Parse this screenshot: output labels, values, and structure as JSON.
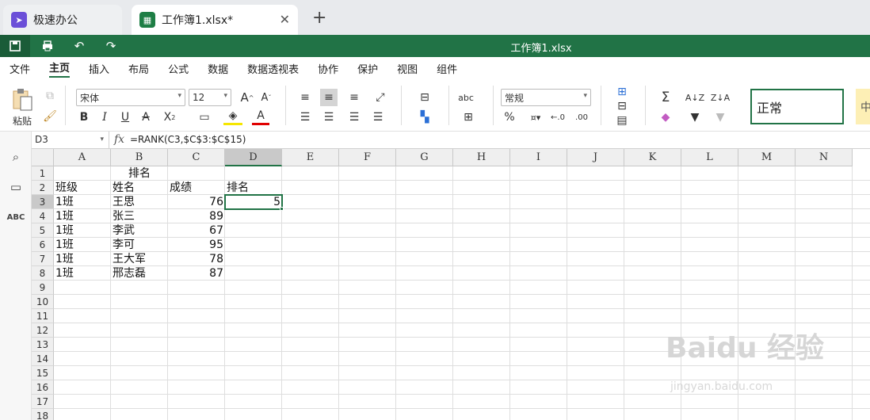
{
  "tabs": [
    {
      "label": "极速办公",
      "icon": "rocket-icon"
    },
    {
      "label": "工作簿1.xlsx*",
      "icon": "spreadsheet-icon"
    }
  ],
  "title_bar": {
    "doc_title": "工作簿1.xlsx"
  },
  "menu": [
    "文件",
    "主页",
    "插入",
    "布局",
    "公式",
    "数据",
    "数据透视表",
    "协作",
    "保护",
    "视图",
    "组件"
  ],
  "ribbon": {
    "paste_label": "粘贴",
    "font_name": "宋体",
    "font_size": "12",
    "number_format": "常规",
    "style_normal": "正常",
    "style_next": "中"
  },
  "formula_bar": {
    "cell_ref": "D3",
    "fx": "fx",
    "formula": "=RANK(C3,$C$3:$C$15)"
  },
  "sheet": {
    "columns": [
      "A",
      "B",
      "C",
      "D",
      "E",
      "F",
      "G",
      "H",
      "I",
      "J",
      "K",
      "L",
      "M",
      "N"
    ],
    "rows": [
      "1",
      "2",
      "3",
      "4",
      "5",
      "6",
      "7",
      "8",
      "9",
      "10",
      "11",
      "12",
      "13",
      "14",
      "15",
      "16",
      "17",
      "18"
    ],
    "title": "排名",
    "headers": [
      "班级",
      "姓名",
      "成绩",
      "排名"
    ],
    "data": [
      {
        "class": "1班",
        "name": "王思",
        "score": "76",
        "rank": "5"
      },
      {
        "class": "1班",
        "name": "张三",
        "score": "89",
        "rank": ""
      },
      {
        "class": "1班",
        "name": "李武",
        "score": "67",
        "rank": ""
      },
      {
        "class": "1班",
        "name": "李可",
        "score": "95",
        "rank": ""
      },
      {
        "class": "1班",
        "name": "王大军",
        "score": "78",
        "rank": ""
      },
      {
        "class": "1班",
        "name": "邢志磊",
        "score": "87",
        "rank": ""
      }
    ]
  },
  "watermark": {
    "brand": "Baidu 经验",
    "url": "jingyan.baidu.com"
  }
}
